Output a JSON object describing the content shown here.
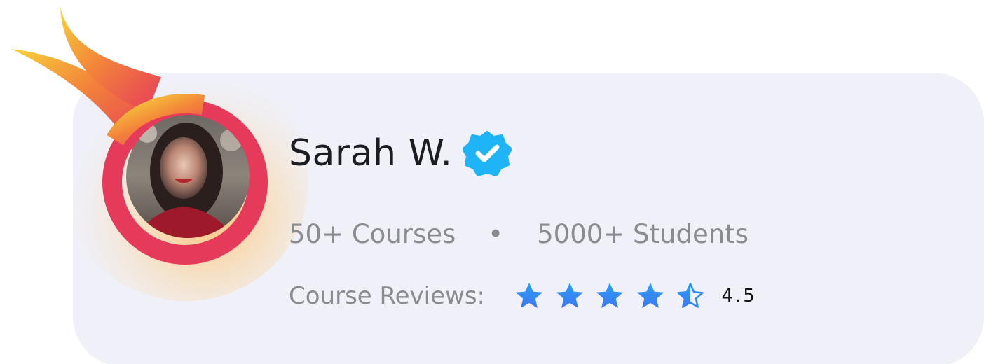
{
  "profile": {
    "name": "Sarah W.",
    "avatar_alt": "Sarah W.",
    "verified_icon": "verified-badge-icon",
    "courses": "50+ Courses",
    "separator": "•",
    "students": "5000+ Students",
    "reviews_label": "Course Reviews:",
    "rating_value": "4.5",
    "rating_numeric": 4.5,
    "rating_max": 5
  },
  "colors": {
    "card_bg": "#eff0f8",
    "name_text": "#1c1c22",
    "muted_text": "#8a8a8f",
    "badge": "#1eb4f5",
    "star_top": "#2a9df9",
    "star_bottom": "#3d78f0",
    "flame_outer": "#e63a5a",
    "flame_inner": "#f3b728"
  }
}
